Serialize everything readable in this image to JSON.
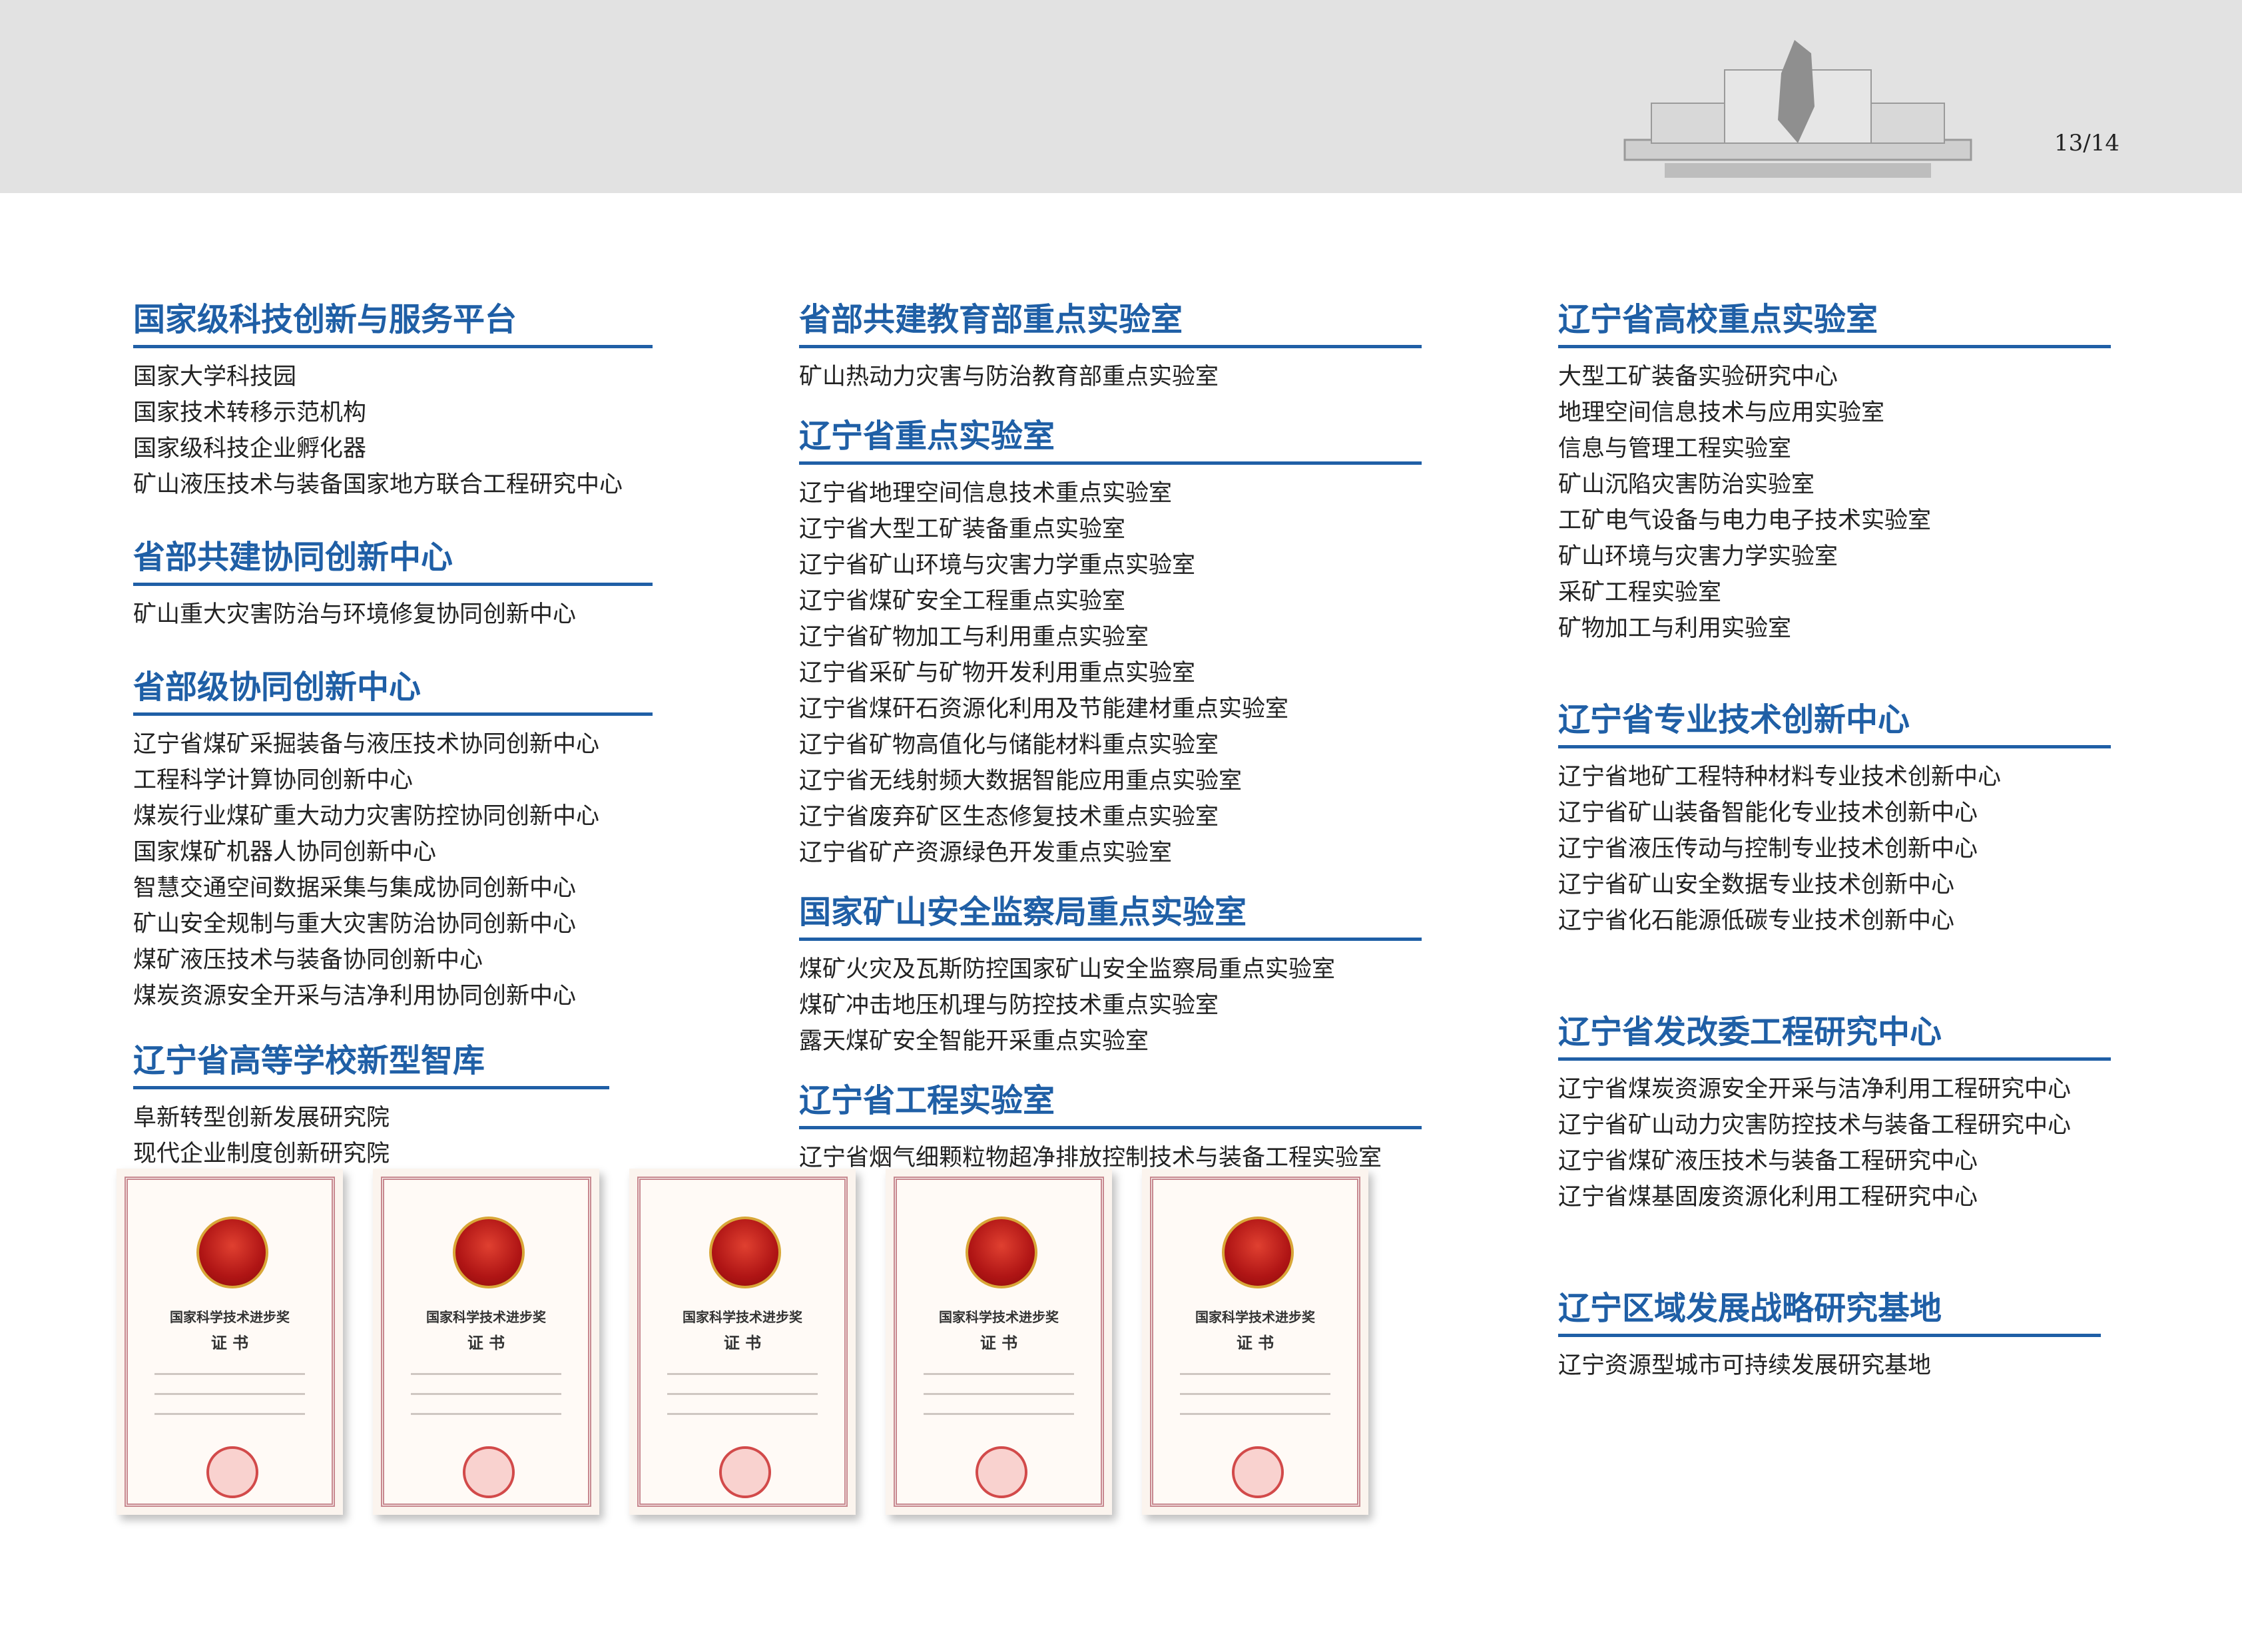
{
  "header": {
    "page_number": "13/14"
  },
  "columns": [
    {
      "sections": [
        {
          "title": "国家级科技创新与服务平台",
          "items": [
            "国家大学科技园",
            "国家技术转移示范机构",
            "国家级科技企业孵化器",
            "矿山液压技术与装备国家地方联合工程研究中心"
          ]
        },
        {
          "title": "省部共建协同创新中心",
          "items": [
            "矿山重大灾害防治与环境修复协同创新中心"
          ]
        },
        {
          "title": "省部级协同创新中心",
          "items": [
            "辽宁省煤矿采掘装备与液压技术协同创新中心",
            "工程科学计算协同创新中心",
            "煤炭行业煤矿重大动力灾害防控协同创新中心",
            "国家煤矿机器人协同创新中心",
            "智慧交通空间数据采集与集成协同创新中心",
            "矿山安全规制与重大灾害防治协同创新中心",
            "煤矿液压技术与装备协同创新中心",
            "煤炭资源安全开采与洁净利用协同创新中心"
          ]
        },
        {
          "title": "辽宁省高等学校新型智库",
          "items": [
            "阜新转型创新发展研究院",
            "现代企业制度创新研究院"
          ]
        }
      ]
    },
    {
      "sections": [
        {
          "title": "省部共建教育部重点实验室",
          "items": [
            "矿山热动力灾害与防治教育部重点实验室"
          ]
        },
        {
          "title": "辽宁省重点实验室",
          "items": [
            "辽宁省地理空间信息技术重点实验室",
            "辽宁省大型工矿装备重点实验室",
            "辽宁省矿山环境与灾害力学重点实验室",
            "辽宁省煤矿安全工程重点实验室",
            "辽宁省矿物加工与利用重点实验室",
            "辽宁省采矿与矿物开发利用重点实验室",
            "辽宁省煤矸石资源化利用及节能建材重点实验室",
            "辽宁省矿物高值化与储能材料重点实验室",
            "辽宁省无线射频大数据智能应用重点实验室",
            "辽宁省废弃矿区生态修复技术重点实验室",
            "辽宁省矿产资源绿色开发重点实验室"
          ]
        },
        {
          "title": "国家矿山安全监察局重点实验室",
          "items": [
            "煤矿火灾及瓦斯防控国家矿山安全监察局重点实验室",
            "煤矿冲击地压机理与防控技术重点实验室",
            "露天煤矿安全智能开采重点实验室"
          ]
        },
        {
          "title": "辽宁省工程实验室",
          "items": [
            "辽宁省烟气细颗粒物超净排放控制技术与装备工程实验室"
          ]
        }
      ]
    },
    {
      "sections": [
        {
          "title": "辽宁省高校重点实验室",
          "items": [
            "大型工矿装备实验研究中心",
            "地理空间信息技术与应用实验室",
            "信息与管理工程实验室",
            "矿山沉陷灾害防治实验室",
            "工矿电气设备与电力电子技术实验室",
            "矿山环境与灾害力学实验室",
            "采矿工程实验室",
            "矿物加工与利用实验室"
          ]
        },
        {
          "title": "辽宁省专业技术创新中心",
          "items": [
            "辽宁省地矿工程特种材料专业技术创新中心",
            "辽宁省矿山装备智能化专业技术创新中心",
            "辽宁省液压传动与控制专业技术创新中心",
            "辽宁省矿山安全数据专业技术创新中心",
            "辽宁省化石能源低碳专业技术创新中心"
          ]
        },
        {
          "title": "辽宁省发改委工程研究中心",
          "items": [
            "辽宁省煤炭资源安全开采与洁净利用工程研究中心",
            "辽宁省矿山动力灾害防控技术与装备工程研究中心",
            "辽宁省煤矿液压技术与装备工程研究中心",
            "辽宁省煤基固废资源化利用工程研究中心"
          ]
        },
        {
          "title": "辽宁区域发展战略研究基地",
          "items": [
            "辽宁资源型城市可持续发展研究基地"
          ]
        }
      ]
    }
  ],
  "certificates": [
    {
      "title": "国家科学技术进步奖",
      "subtitle": "证 书"
    },
    {
      "title": "国家科学技术进步奖",
      "subtitle": "证 书"
    },
    {
      "title": "国家科学技术进步奖",
      "subtitle": "证 书"
    },
    {
      "title": "国家科学技术进步奖",
      "subtitle": "证 书"
    },
    {
      "title": "国家科学技术进步奖",
      "subtitle": "证 书"
    }
  ],
  "colors": {
    "heading": "#1f5fa6",
    "header_band": "#e2e2e2"
  }
}
